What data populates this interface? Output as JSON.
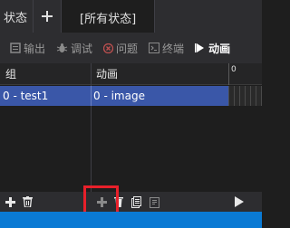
{
  "state_tabs": {
    "first_label": "状态",
    "active_label": "[所有状态]"
  },
  "panel_tabs": [
    {
      "label": "输出",
      "icon": "output-icon"
    },
    {
      "label": "调试",
      "icon": "bug-icon"
    },
    {
      "label": "问题",
      "icon": "error-icon"
    },
    {
      "label": "终端",
      "icon": "terminal-icon"
    },
    {
      "label": "动画",
      "icon": "animation-icon",
      "active": true
    }
  ],
  "table": {
    "columns": [
      "组",
      "动画"
    ],
    "timeline_tick": "0",
    "rows": [
      {
        "group": "0 - test1",
        "animation": "0 - image",
        "selected": true
      }
    ]
  },
  "bottom_bar": {
    "buttons": [
      "add-group",
      "delete-group",
      "add-animation",
      "delete-animation",
      "copy-animation",
      "paste-animation",
      "play"
    ]
  },
  "colors": {
    "selection": "#3a57a8",
    "highlight": "#e8202a",
    "status": "#0a7ad4"
  }
}
